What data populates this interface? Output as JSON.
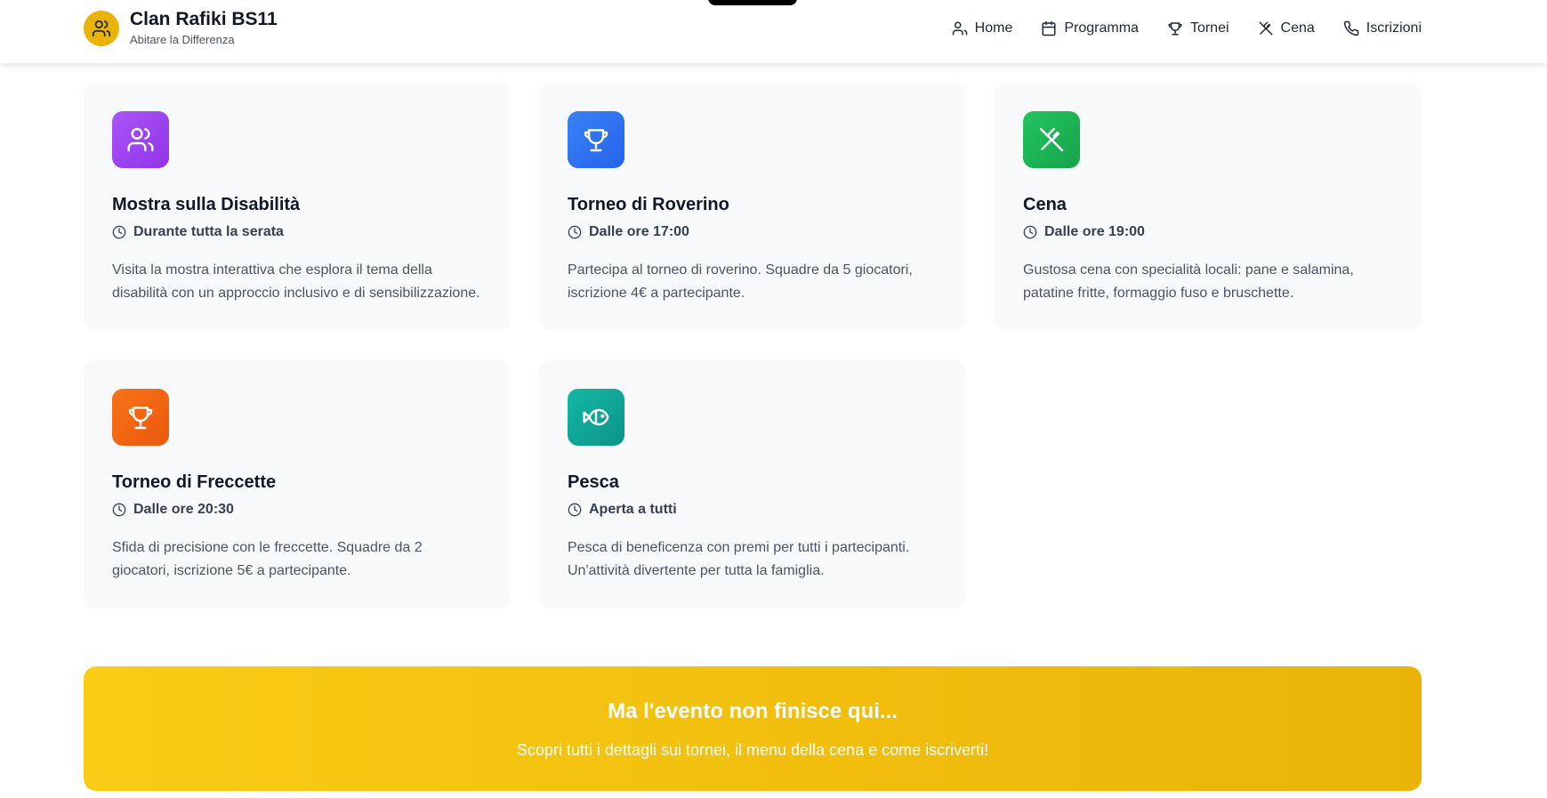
{
  "header": {
    "brand_title": "Clan Rafiki BS11",
    "brand_subtitle": "Abitare la Differenza",
    "logo_icon": "users-icon",
    "nav": [
      {
        "label": "Home",
        "icon": "user-icon"
      },
      {
        "label": "Programma",
        "icon": "calendar-icon"
      },
      {
        "label": "Tornei",
        "icon": "trophy-icon"
      },
      {
        "label": "Cena",
        "icon": "utensils-icon"
      },
      {
        "label": "Iscrizioni",
        "icon": "phone-icon"
      }
    ]
  },
  "cards": [
    {
      "title": "Mostra sulla Disabilità",
      "time": "Durante tutta la serata",
      "description": "Visita la mostra interattiva che esplora il tema della disabilità con un approccio inclusivo e di sensibilizzazione.",
      "icon": "users-icon",
      "color_from": "#a855f7",
      "color_to": "#9333ea"
    },
    {
      "title": "Torneo di Roverino",
      "time": "Dalle ore 17:00",
      "description": "Partecipa al torneo di roverino. Squadre da 5 giocatori, iscrizione 4€ a partecipante.",
      "icon": "trophy-icon",
      "color_from": "#3b82f6",
      "color_to": "#2563eb"
    },
    {
      "title": "Cena",
      "time": "Dalle ore 19:00",
      "description": "Gustosa cena con specialità locali: pane e salamina, patatine fritte, formaggio fuso e bruschette.",
      "icon": "utensils-icon",
      "color_from": "#22c55e",
      "color_to": "#16a34a"
    },
    {
      "title": "Torneo di Freccette",
      "time": "Dalle ore 20:30",
      "description": "Sfida di precisione con le freccette. Squadre da 2 giocatori, iscrizione 5€ a partecipante.",
      "icon": "trophy-icon",
      "color_from": "#f97316",
      "color_to": "#ea580c"
    },
    {
      "title": "Pesca",
      "time": "Aperta a tutti",
      "description": "Pesca di beneficenza con premi per tutti i partecipanti. Un'attività divertente per tutta la famiglia.",
      "icon": "fish-icon",
      "color_from": "#14b8a6",
      "color_to": "#0d9488"
    }
  ],
  "cta": {
    "title": "Ma l'evento non finisce qui...",
    "text": "Scopri tutti i dettagli sui tornei, il menu della cena e come iscriverti!"
  }
}
